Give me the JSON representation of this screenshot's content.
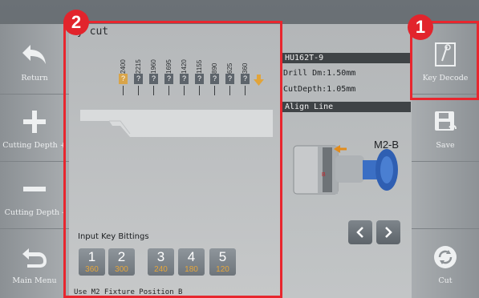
{
  "left_sidebar": {
    "items": [
      {
        "label": "Return",
        "icon": "return-arrow-icon"
      },
      {
        "label": "Cutting Depth +",
        "icon": "plus-icon"
      },
      {
        "label": "Cutting Depth -",
        "icon": "minus-icon"
      },
      {
        "label": "Main Menu",
        "icon": "back-arrow-icon"
      }
    ]
  },
  "right_sidebar": {
    "items": [
      {
        "label": "Key Decode",
        "icon": "key-decode-icon"
      },
      {
        "label": "Save",
        "icon": "save-icon"
      },
      {
        "label": "Cut",
        "icon": "cut-refresh-icon"
      }
    ]
  },
  "main": {
    "title_visible": "y cut",
    "cut_values": [
      "2400",
      "2215",
      "1960",
      "1695",
      "1420",
      "1155",
      "890",
      "625",
      "360"
    ],
    "cut_markers": [
      "?",
      "?",
      "?",
      "?",
      "?",
      "?",
      "?",
      "?",
      "?"
    ],
    "input_label": "Input Key Bittings",
    "bitting_buttons": [
      {
        "num": "1",
        "value": "360"
      },
      {
        "num": "2",
        "value": "300"
      },
      {
        "num": "3",
        "value": "240"
      },
      {
        "num": "4",
        "value": "180"
      },
      {
        "num": "5",
        "value": "120"
      }
    ],
    "status_text": "Use M2 Fixture Position B"
  },
  "info": {
    "key_model": "HU162T-9",
    "drill": "Drill Dm:1.50mm",
    "cut_depth": "CutDepth:1.05mm",
    "align_header": "Align Line",
    "fixture_label": "M2-B",
    "fixture_side_label": "B"
  },
  "annotations": {
    "badge_1": "1",
    "badge_2": "2"
  },
  "colors": {
    "highlight": "#e8262e",
    "selected_cut": "#d8a449",
    "bitting_value": "#e6a63a"
  }
}
